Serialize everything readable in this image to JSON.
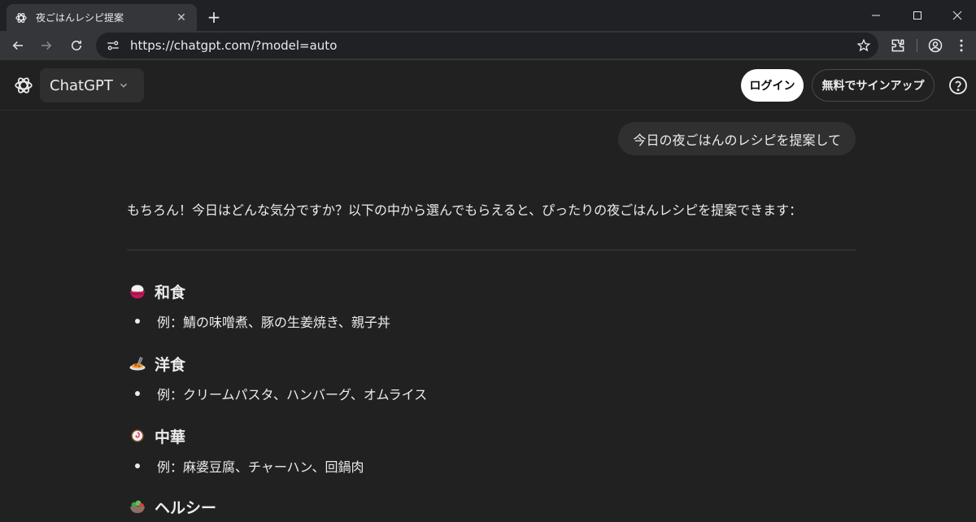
{
  "browser": {
    "tab_title": "夜ごはんレシピ提案",
    "url": "https://chatgpt.com/?model=auto"
  },
  "header": {
    "model_label": "ChatGPT",
    "login_label": "ログイン",
    "signup_label": "無料でサインアップ"
  },
  "conversation": {
    "user_message": "今日の夜ごはんのレシピを提案して",
    "reply_intro": "もちろん！今日はどんな気分ですか？以下の中から選んでもらえると、ぴったりの夜ごはんレシピを提案できます：",
    "sections": [
      {
        "icon": "rice-bowl-icon",
        "title": "和食",
        "example": "例：鯖の味噌煮、豚の生姜焼き、親子丼"
      },
      {
        "icon": "spaghetti-icon",
        "title": "洋食",
        "example": "例：クリームパスタ、ハンバーグ、オムライス"
      },
      {
        "icon": "fish-cake-icon",
        "title": "中華",
        "example": "例：麻婆豆腐、チャーハン、回鍋肉"
      },
      {
        "icon": "salad-icon",
        "title": "ヘルシー",
        "example": ""
      }
    ]
  }
}
